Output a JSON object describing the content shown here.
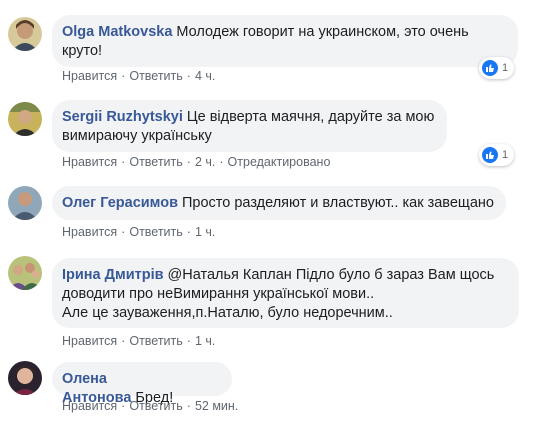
{
  "labels": {
    "like": "Нравится",
    "reply": "Ответить",
    "dot": "·"
  },
  "comments": [
    {
      "author": "Olga Matkovska",
      "text_lines": [
        "Молодеж говорит на украинском, это очень",
        "круто!"
      ],
      "time": "4 ч.",
      "edited": "",
      "reaction_count": "1"
    },
    {
      "author": "Sergii Ruzhytskyi",
      "text_lines": [
        "Це відверта маячня, даруйте за мою",
        "вимираючу українську"
      ],
      "time": "2 ч.",
      "edited": "Отредактировано",
      "reaction_count": "1"
    },
    {
      "author": "Олег Герасимов",
      "text_lines": [
        "Просто разделяют и властвуют.. как завещано"
      ],
      "time": "1 ч.",
      "edited": "",
      "reaction_count": ""
    },
    {
      "author": "Ірина Дмитрів",
      "text_lines": [
        "@Наталья Каплан Підло було б зараз Вам щось",
        "доводити про неВимирання української мови..",
        "Але це зауваження,п.Наталю, було недоречним.."
      ],
      "time": "1 ч.",
      "edited": "",
      "reaction_count": ""
    },
    {
      "author": "Олена Антонова",
      "text_lines": [
        "Бред!"
      ],
      "time": "52 мин.",
      "edited": "",
      "reaction_count": ""
    }
  ],
  "colors": {
    "author": "#385898",
    "bubble": "#f2f3f5",
    "meta": "#606770",
    "like_blue": "#1877f2"
  },
  "icons": {
    "reaction": "thumbs-up-icon"
  }
}
